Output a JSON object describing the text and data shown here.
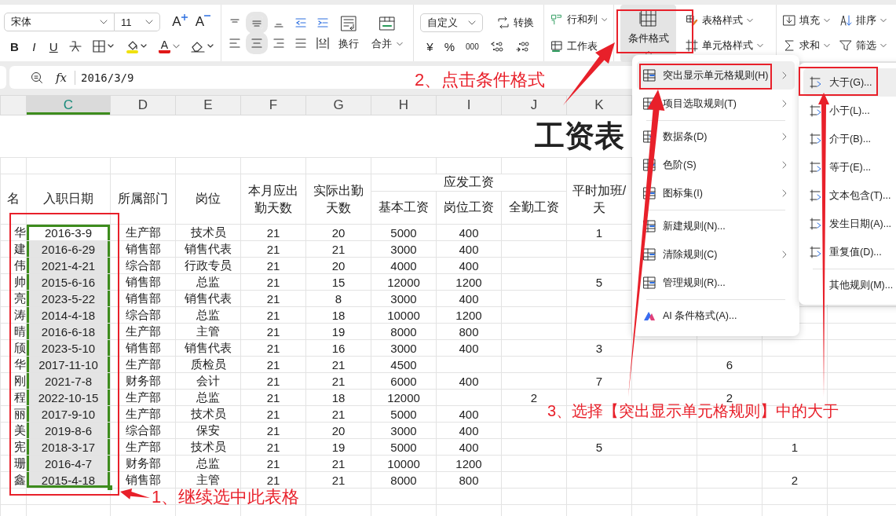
{
  "ribbon": {
    "font_family": "宋体",
    "font_size": "11",
    "grow_font_button": "A",
    "shrink_font_button": "A",
    "style_buttons": [
      "B",
      "I",
      "U"
    ],
    "font_color_button": "A",
    "wrap_button": "换行",
    "merge_button": "合并",
    "number_format": "自定义",
    "convert_button": "转换",
    "currency_button": "¥",
    "percent_button": "%",
    "thousands_button": "000",
    "rows_columns_button": "行和列",
    "worksheet_button": "工作表",
    "conditional_format_button": {
      "label": "条件格式",
      "selected": true
    },
    "table_style_button": "表格样式",
    "cell_style_button": "单元格样式",
    "fill_button": "填充",
    "sort_button": "排序",
    "sum_button": "求和",
    "filter_button": "筛选"
  },
  "formula_bar": {
    "function_label": "fx",
    "value": "2016/3/9"
  },
  "sheet": {
    "column_headers": [
      {
        "label": "C",
        "selected": true
      },
      {
        "label": "D",
        "selected": false
      },
      {
        "label": "E",
        "selected": false
      },
      {
        "label": "F",
        "selected": false
      },
      {
        "label": "G",
        "selected": false
      },
      {
        "label": "H",
        "selected": false
      },
      {
        "label": "I",
        "selected": false
      },
      {
        "label": "J",
        "selected": false
      },
      {
        "label": "K",
        "selected": false
      }
    ],
    "title": "工资表",
    "headers": {
      "name": "名",
      "date": "入职日期",
      "dept": "所属部门",
      "post": "岗位",
      "days_due": "本月应出勤天数",
      "days_worked": "实际出勤天数",
      "pay_group": "应发工资",
      "base_pay": "基本工资",
      "post_pay": "岗位工资",
      "full_attendance": "全勤工资",
      "overtime": "平时加班/天"
    },
    "rows": [
      {
        "name": "华",
        "date": "2016-3-9",
        "dept": "生产部",
        "post": "技术员",
        "days_due": "21",
        "days_worked": "20",
        "base_pay": "5000",
        "post_pay": "400",
        "overtime": "1"
      },
      {
        "name": "建",
        "date": "2016-6-29",
        "dept": "销售部",
        "post": "销售代表",
        "days_due": "21",
        "days_worked": "21",
        "base_pay": "3000",
        "post_pay": "400"
      },
      {
        "name": "伟",
        "date": "2021-4-21",
        "dept": "综合部",
        "post": "行政专员",
        "days_due": "21",
        "days_worked": "20",
        "base_pay": "4000",
        "post_pay": "400"
      },
      {
        "name": "帅",
        "date": "2015-6-16",
        "dept": "销售部",
        "post": "总监",
        "days_due": "21",
        "days_worked": "15",
        "base_pay": "12000",
        "post_pay": "1200",
        "overtime": "5"
      },
      {
        "name": "亮",
        "date": "2023-5-22",
        "dept": "销售部",
        "post": "销售代表",
        "days_due": "21",
        "days_worked": "8",
        "base_pay": "3000",
        "post_pay": "400"
      },
      {
        "name": "涛",
        "date": "2014-4-18",
        "dept": "综合部",
        "post": "总监",
        "days_due": "21",
        "days_worked": "18",
        "base_pay": "10000",
        "post_pay": "1200"
      },
      {
        "name": "晴",
        "date": "2016-6-18",
        "dept": "生产部",
        "post": "主管",
        "days_due": "21",
        "days_worked": "19",
        "base_pay": "8000",
        "post_pay": "800"
      },
      {
        "name": "颀",
        "date": "2023-5-10",
        "dept": "销售部",
        "post": "销售代表",
        "days_due": "21",
        "days_worked": "16",
        "base_pay": "3000",
        "post_pay": "400",
        "overtime": "3"
      },
      {
        "name": "华",
        "date": "2017-11-10",
        "dept": "生产部",
        "post": "质检员",
        "days_due": "21",
        "days_worked": "21",
        "base_pay": "4500",
        "column_13": "6"
      },
      {
        "name": "刚",
        "date": "2021-7-8",
        "dept": "财务部",
        "post": "会计",
        "days_due": "21",
        "days_worked": "21",
        "base_pay": "6000",
        "post_pay": "400",
        "overtime": "7"
      },
      {
        "name": "程",
        "date": "2022-10-15",
        "dept": "生产部",
        "post": "总监",
        "days_due": "21",
        "days_worked": "18",
        "base_pay": "12000",
        "full_attendance": "2",
        "column_13": "2"
      },
      {
        "name": "丽",
        "date": "2017-9-10",
        "dept": "生产部",
        "post": "技术员",
        "days_due": "21",
        "days_worked": "21",
        "base_pay": "5000",
        "post_pay": "400"
      },
      {
        "name": "美",
        "date": "2019-8-6",
        "dept": "综合部",
        "post": "保安",
        "days_due": "21",
        "days_worked": "20",
        "base_pay": "3000",
        "post_pay": "400"
      },
      {
        "name": "宪",
        "date": "2018-3-17",
        "dept": "生产部",
        "post": "技术员",
        "days_due": "21",
        "days_worked": "19",
        "base_pay": "5000",
        "post_pay": "400",
        "overtime": "5",
        "column_14": "1"
      },
      {
        "name": "珊",
        "date": "2016-4-7",
        "dept": "财务部",
        "post": "总监",
        "days_due": "21",
        "days_worked": "21",
        "base_pay": "10000",
        "post_pay": "1200"
      },
      {
        "name": "鑫",
        "date": "2015-4-18",
        "dept": "销售部",
        "post": "主管",
        "days_due": "21",
        "days_worked": "21",
        "base_pay": "8000",
        "post_pay": "800",
        "column_14": "2"
      }
    ]
  },
  "conditional_format_menu": {
    "groups": [
      {
        "items": [
          {
            "label": "突出显示单元格规则(H)",
            "kind": "submenu",
            "selected": true
          },
          {
            "label": "项目选取规则(T)",
            "kind": "submenu",
            "selected": false
          }
        ]
      },
      {
        "items": [
          {
            "label": "数据条(D)",
            "kind": "submenu",
            "selected": false
          },
          {
            "label": "色阶(S)",
            "kind": "submenu",
            "selected": false
          },
          {
            "label": "图标集(I)",
            "kind": "submenu",
            "selected": false
          }
        ]
      },
      {
        "items": [
          {
            "label": "新建规则(N)...",
            "kind": "command",
            "selected": false
          },
          {
            "label": "清除规则(C)",
            "kind": "submenu",
            "selected": false
          },
          {
            "label": "管理规则(R)...",
            "kind": "command",
            "selected": false
          }
        ]
      },
      {
        "items": [
          {
            "label": "AI 条件格式(A)...",
            "kind": "ai",
            "selected": false
          }
        ]
      }
    ]
  },
  "highlight_rules_submenu": {
    "groups": [
      {
        "items": [
          {
            "label": "大于(G)...",
            "selected": true
          },
          {
            "label": "小于(L)...",
            "selected": false
          },
          {
            "label": "介于(B)...",
            "selected": false
          },
          {
            "label": "等于(E)...",
            "selected": false
          },
          {
            "label": "文本包含(T)...",
            "selected": false
          },
          {
            "label": "发生日期(A)...",
            "selected": false
          },
          {
            "label": "重复值(D)...",
            "selected": false
          }
        ]
      },
      {
        "items": [
          {
            "label": "其他规则(M)...",
            "selected": false,
            "kind": "plain"
          }
        ]
      }
    ]
  },
  "annotations": [
    {
      "text": "1、继续选中此表格"
    },
    {
      "text": "2、点击条件格式"
    },
    {
      "text": "3、选择【突出显示单元格规则】中的大于"
    }
  ]
}
